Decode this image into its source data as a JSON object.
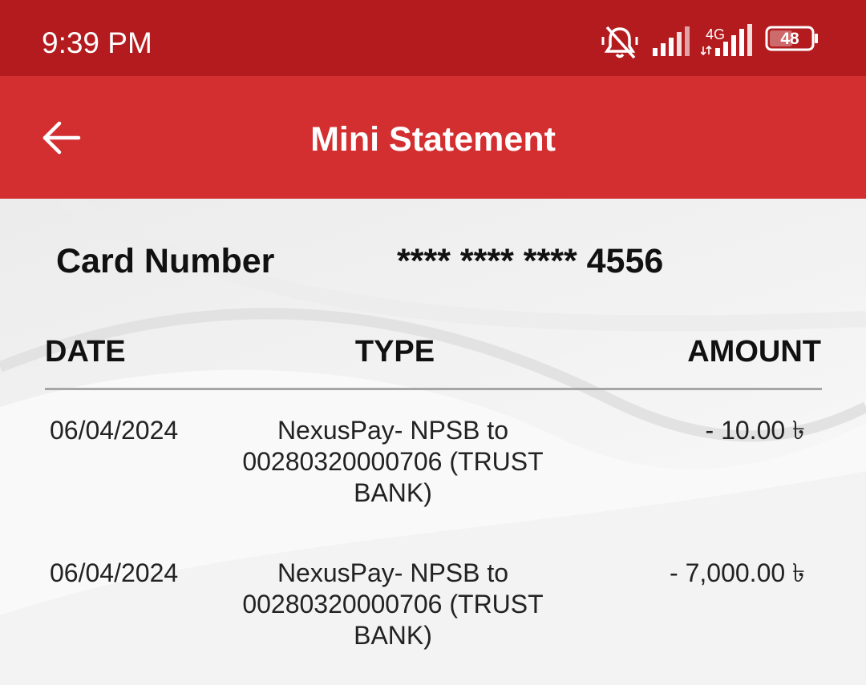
{
  "status_bar": {
    "time": "9:39 PM",
    "network_label": "4G",
    "battery_level": "48",
    "icons": [
      "mute-notifications-icon",
      "signal-icon",
      "signal-4g-icon",
      "battery-icon"
    ]
  },
  "app_bar": {
    "title": "Mini Statement",
    "back_icon": "arrow-left-icon"
  },
  "card": {
    "label": "Card Number",
    "value": "**** **** **** 4556"
  },
  "table": {
    "columns": [
      "DATE",
      "TYPE",
      "AMOUNT"
    ],
    "rows": [
      {
        "date": "06/04/2024",
        "type": "NexusPay- NPSB to 00280320000706 (TRUST BANK)",
        "amount": "- 10.00 ৳"
      },
      {
        "date": "06/04/2024",
        "type": "NexusPay- NPSB to 00280320000706 (TRUST BANK)",
        "amount": "- 7,000.00 ৳"
      }
    ]
  },
  "colors": {
    "status_bar": "#b31b1e",
    "app_bar": "#d32f30",
    "background": "#f8f8f8",
    "text": "#111111"
  }
}
